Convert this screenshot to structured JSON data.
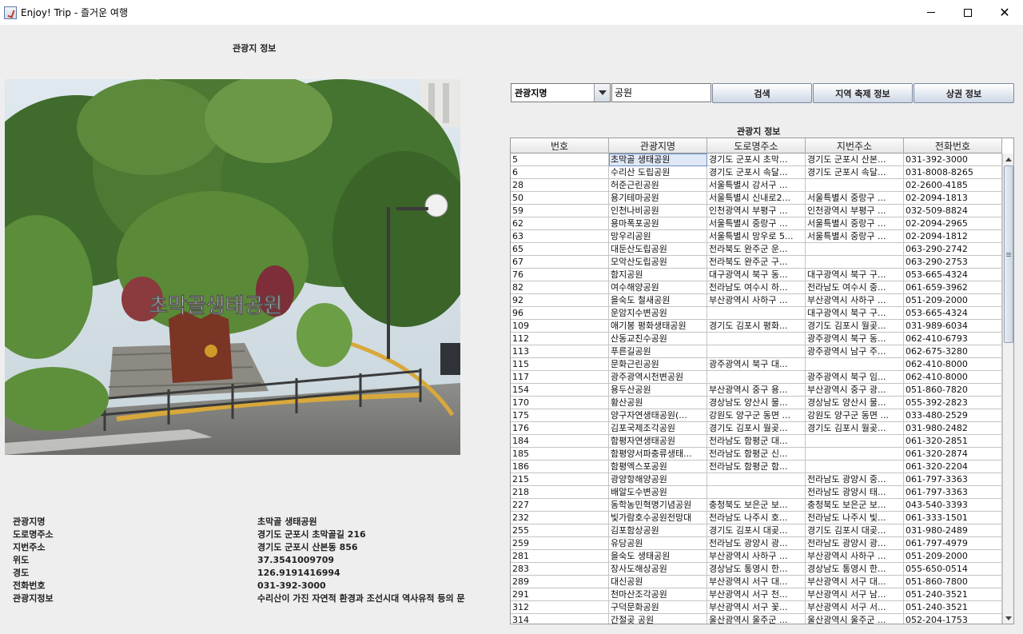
{
  "window": {
    "title": "Enjoy! Trip - 즐거운 여행",
    "close_glyph": "✕"
  },
  "left": {
    "heading": "관광지 정보",
    "photo_text": "초막골생태공원",
    "info_labels": [
      "관광지명",
      "도로명주소",
      "지번주소",
      "위도",
      "경도",
      "전화번호",
      "관광지정보"
    ],
    "info_values": [
      "초막골 생태공원",
      "경기도 군포시 초막골길 216",
      "경기도 군포시 산본동 856",
      "37.3541009709",
      "126.9191416994",
      "031-392-3000",
      "수리산이 가진 자연적 환경과 조선시대 역사유적 등의 문"
    ]
  },
  "toolbar": {
    "combo_value": "관광지명",
    "search_value": "공원",
    "search_label": "검색",
    "festival_label": "지역 축제 정보",
    "commerce_label": "상권 정보"
  },
  "table": {
    "heading": "관광지 정보",
    "columns": [
      "번호",
      "관광지명",
      "도로명주소",
      "지번주소",
      "전화번호"
    ],
    "selected_row": 0,
    "selected_col": 1,
    "rows": [
      [
        "5",
        "초막골 생태공원",
        "경기도 군포시 초막...",
        "경기도 군포시 산본...",
        "031-392-3000"
      ],
      [
        "6",
        "수리산 도립공원",
        "경기도 군포시 속달...",
        "경기도 군포시 속달...",
        "031-8008-8265"
      ],
      [
        "28",
        "허준근린공원",
        "서울특별시 강서구 ...",
        "",
        "02-2600-4185"
      ],
      [
        "50",
        "용기테마공원",
        "서울특별시 신내로2...",
        "서울특별시 중랑구 ...",
        "02-2094-1813"
      ],
      [
        "59",
        "인천나비공원",
        "인천광역시 부평구 ...",
        "인천광역시 부평구 ...",
        "032-509-8824"
      ],
      [
        "62",
        "용마폭포공원",
        "서울특별시 중랑구 ...",
        "서울특별시 중랑구 ...",
        "02-2094-2965"
      ],
      [
        "63",
        "망우리공원",
        "서울특별시 망우로 5...",
        "서울특별시 중랑구 ...",
        "02-2094-1812"
      ],
      [
        "65",
        "대둔산도립공원",
        "전라북도 완주군 운...",
        "",
        "063-290-2742"
      ],
      [
        "67",
        "모악산도립공원",
        "전라북도 완주군 구...",
        "",
        "063-290-2753"
      ],
      [
        "76",
        "함지공원",
        "대구광역시 북구 동...",
        "대구광역시 북구 구...",
        "053-665-4324"
      ],
      [
        "82",
        "여수해양공원",
        "전라남도 여수시 하...",
        "전라남도 여수시 중...",
        "061-659-3962"
      ],
      [
        "92",
        "을숙도 철새공원",
        "부산광역시 사하구 ...",
        "부산광역시 사하구 ...",
        "051-209-2000"
      ],
      [
        "96",
        "운암지수변공원",
        "",
        "대구광역시 북구 구...",
        "053-665-4324"
      ],
      [
        "109",
        "애기봉 평화생태공원",
        "경기도 김포시 평화...",
        "경기도 김포시 월곶...",
        "031-989-6034"
      ],
      [
        "112",
        "산동교친수공원",
        "",
        "광주광역시 북구 동...",
        "062-410-6793"
      ],
      [
        "113",
        "푸른길공원",
        "",
        "광주광역시 남구 주...",
        "062-675-3280"
      ],
      [
        "115",
        "문화근린공원",
        "광주광역시 북구 대...",
        "",
        "062-410-8000"
      ],
      [
        "117",
        "광주광역시천변공원",
        "",
        "광주광역시 북구 임...",
        "062-410-8000"
      ],
      [
        "154",
        "용두산공원",
        "부산광역시 중구 용...",
        "부산광역시 중구 광...",
        "051-860-7820"
      ],
      [
        "170",
        "황산공원",
        "경상남도 양산시 물...",
        "경상남도 양산시 물...",
        "055-392-2823"
      ],
      [
        "175",
        "양구자연생태공원(...",
        "강원도 양구군 동면 ...",
        "강원도 양구군 동면 ...",
        "033-480-2529"
      ],
      [
        "176",
        "김포국제조각공원",
        "경기도 김포시 월곶...",
        "경기도 김포시 월곶...",
        "031-980-2482"
      ],
      [
        "184",
        "함평자연생태공원",
        "전라남도 함평군 대...",
        "",
        "061-320-2851"
      ],
      [
        "185",
        "함평양서파충류생태...",
        "전라남도 함평군 신...",
        "",
        "061-320-2874"
      ],
      [
        "186",
        "함평엑스포공원",
        "전라남도 함평군 함...",
        "",
        "061-320-2204"
      ],
      [
        "215",
        "광양항해양공원",
        "",
        "전라남도 광양시 중...",
        "061-797-3363"
      ],
      [
        "218",
        "배알도수변공원",
        "",
        "전라남도 광양시 태...",
        "061-797-3363"
      ],
      [
        "227",
        "동학농민혁명기념공원",
        "충청북도 보은군 보...",
        "충청북도 보은군 보...",
        "043-540-3393"
      ],
      [
        "232",
        "빛가람호수공원전망대",
        "전라남도 나주시 호...",
        "전라남도 나주시 빛...",
        "061-333-1501"
      ],
      [
        "255",
        "김포함상공원",
        "경기도 김포시 대곶...",
        "경기도 김포시 대곶...",
        "031-980-2489"
      ],
      [
        "259",
        "유당공원",
        "전라남도 광양시 광...",
        "전라남도 광양시 광...",
        "061-797-4979"
      ],
      [
        "281",
        "을숙도 생태공원",
        "부산광역시 사하구 ...",
        "부산광역시 사하구 ...",
        "051-209-2000"
      ],
      [
        "283",
        "장사도해상공원",
        "경상남도 통영시 한...",
        "경상남도 통영시 한...",
        "055-650-0514"
      ],
      [
        "289",
        "대신공원",
        "부산광역시 서구 대...",
        "부산광역시 서구 대...",
        "051-860-7800"
      ],
      [
        "291",
        "천마산조각공원",
        "부산광역시 서구 천...",
        "부산광역시 서구 남...",
        "051-240-3521"
      ],
      [
        "312",
        "구덕문화공원",
        "부산광역시 서구 꽃...",
        "부산광역시 서구 서...",
        "051-240-3521"
      ],
      [
        "314",
        "간절곶 공원",
        "울산광역시 울주군 ...",
        "울산광역시 울주군 ...",
        "052-204-1753"
      ]
    ]
  }
}
